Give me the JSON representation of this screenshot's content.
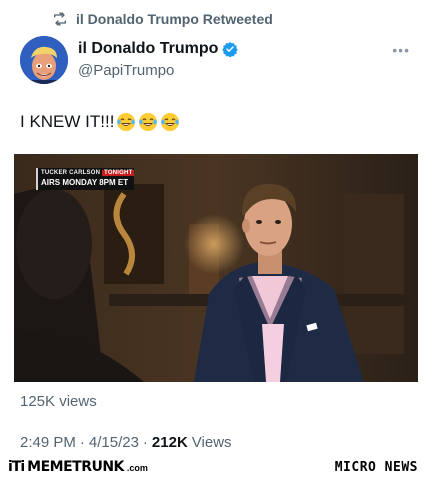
{
  "retweet": {
    "label": "il Donaldo Trumpo Retweeted"
  },
  "author": {
    "name": "il Donaldo Trumpo",
    "handle": "@PapiTrumpo",
    "verified": true
  },
  "tweet": {
    "text": "I KNEW IT!!!",
    "emoji_icons": [
      "laughing-tears-emoji",
      "laughing-tears-emoji",
      "laughing-tears-emoji"
    ]
  },
  "media": {
    "chyron_top_name": "TUCKER CARLSON",
    "chyron_top_tag": "TONIGHT",
    "chyron_bottom": "AIRS MONDAY 8PM ET"
  },
  "stats": {
    "views_line": "125K views",
    "time": "2:49 PM",
    "sep1": "·",
    "date": "4/15/23",
    "sep2": "·",
    "views_count": "212K",
    "views_label": "Views"
  },
  "footer": {
    "brand_mark": "iTi",
    "brand_name": "MEMETRUNK",
    "brand_domain": ".com",
    "right_brand": "MICRO NEWS"
  },
  "colors": {
    "text": "#0f1419",
    "secondary": "#536471",
    "verified": "#1d9bf0"
  }
}
